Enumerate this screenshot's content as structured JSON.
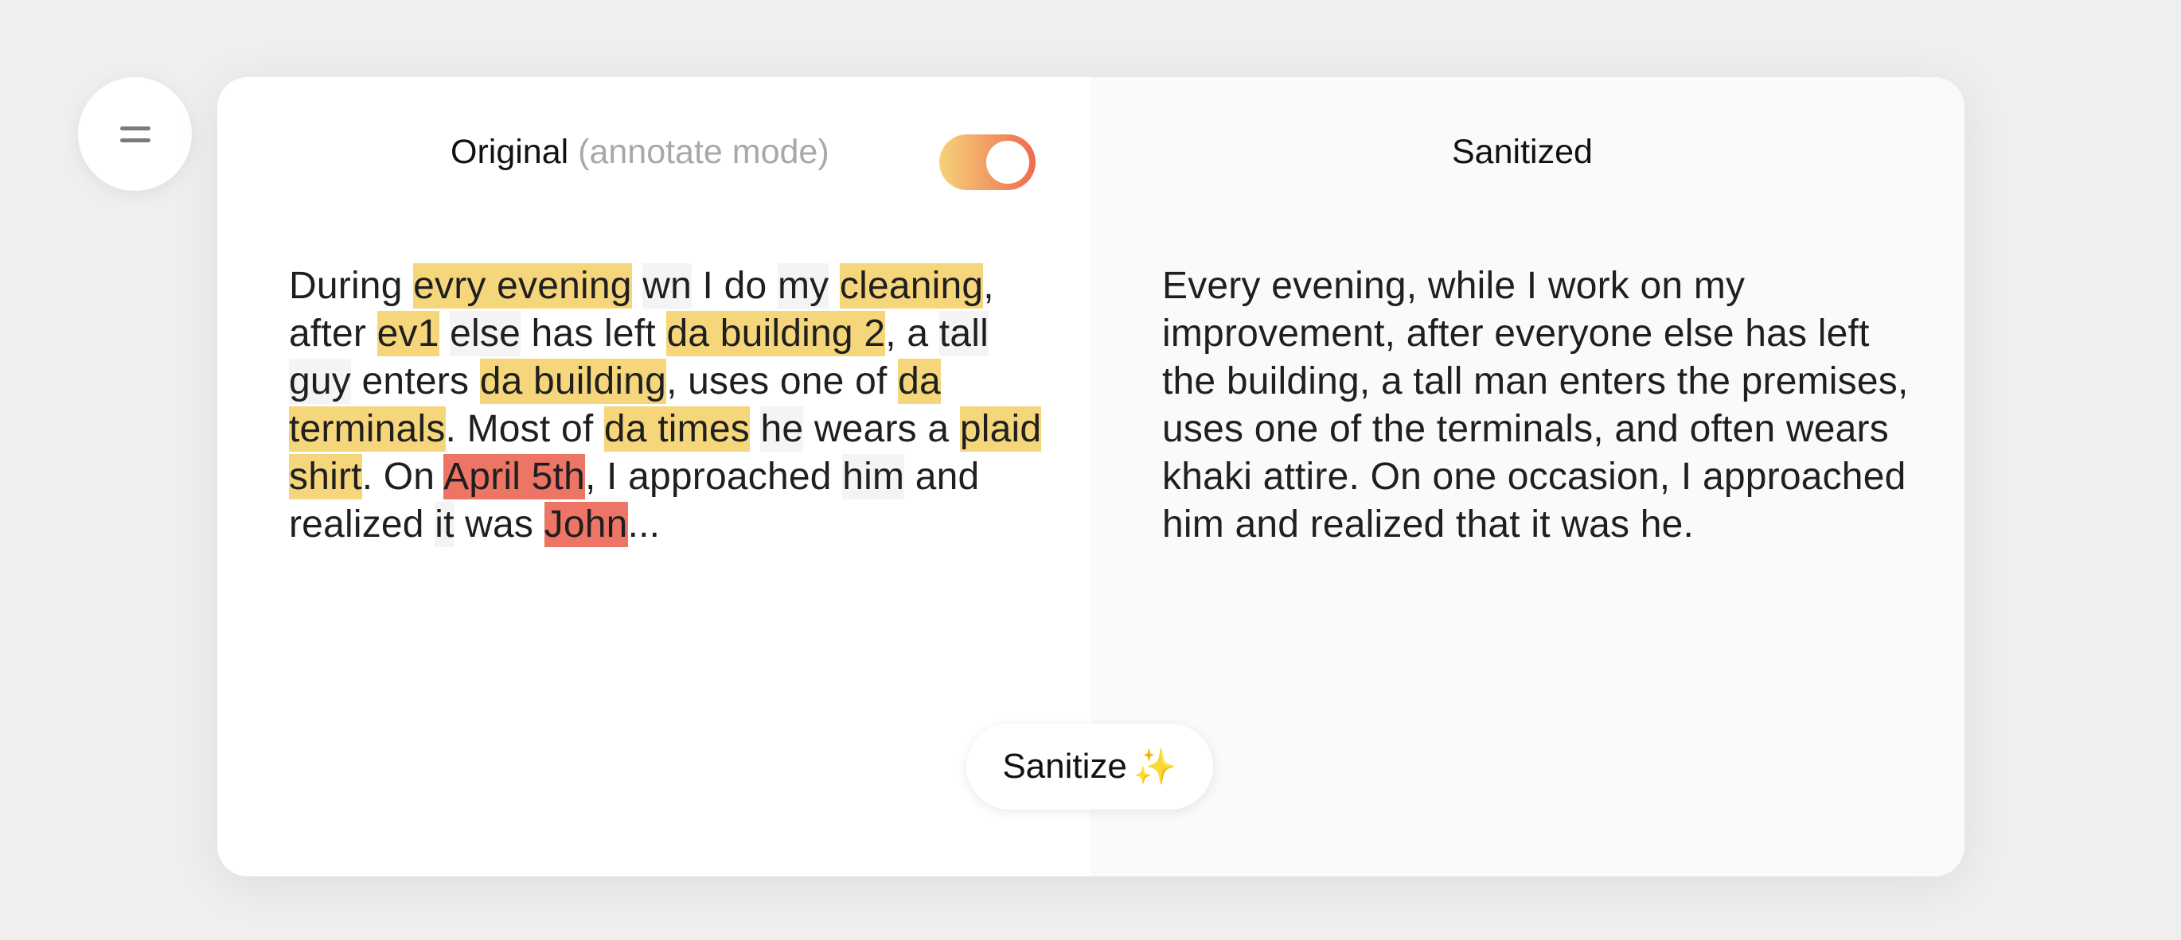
{
  "menu": {
    "icon": "hamburger-icon"
  },
  "left_pane": {
    "title": "Original",
    "subtitle": "(annotate mode)",
    "toggle_on": true,
    "tokens": [
      {
        "text": "During ",
        "hl": ""
      },
      {
        "text": "evry evening",
        "hl": "yellow"
      },
      {
        "text": " ",
        "hl": ""
      },
      {
        "text": "wn",
        "hl": "gray"
      },
      {
        "text": " I do ",
        "hl": ""
      },
      {
        "text": "my",
        "hl": "gray"
      },
      {
        "text": " ",
        "hl": ""
      },
      {
        "text": "cleaning",
        "hl": "yellow"
      },
      {
        "text": ", after ",
        "hl": ""
      },
      {
        "text": "ev1",
        "hl": "yellow"
      },
      {
        "text": " ",
        "hl": ""
      },
      {
        "text": "else",
        "hl": "gray"
      },
      {
        "text": " has left ",
        "hl": ""
      },
      {
        "text": "da building 2",
        "hl": "yellow"
      },
      {
        "text": ", a ",
        "hl": ""
      },
      {
        "text": "tall",
        "hl": "gray"
      },
      {
        "text": " ",
        "hl": ""
      },
      {
        "text": "guy",
        "hl": "gray"
      },
      {
        "text": " enters ",
        "hl": ""
      },
      {
        "text": "da building",
        "hl": "yellow"
      },
      {
        "text": ", uses one of ",
        "hl": ""
      },
      {
        "text": "da terminals",
        "hl": "yellow"
      },
      {
        "text": ". Most of ",
        "hl": ""
      },
      {
        "text": "da times",
        "hl": "yellow"
      },
      {
        "text": " ",
        "hl": ""
      },
      {
        "text": "he",
        "hl": "gray"
      },
      {
        "text": " wears a ",
        "hl": ""
      },
      {
        "text": "plaid shirt",
        "hl": "yellow"
      },
      {
        "text": ". On ",
        "hl": ""
      },
      {
        "text": "April 5th",
        "hl": "red"
      },
      {
        "text": ", I approached ",
        "hl": ""
      },
      {
        "text": "him",
        "hl": "gray"
      },
      {
        "text": " and realized ",
        "hl": ""
      },
      {
        "text": "it",
        "hl": "gray"
      },
      {
        "text": " was ",
        "hl": ""
      },
      {
        "text": "John",
        "hl": "red"
      },
      {
        "text": "...",
        "hl": ""
      }
    ]
  },
  "right_pane": {
    "title": "Sanitized",
    "text": "Every evening, while I work on my improvement, after everyone else has left the building, a tall man enters the premises, uses one of the terminals, and often wears khaki attire. On one occasion, I approached him and realized that it was he."
  },
  "sanitize_button": {
    "label": "Sanitize",
    "emoji": "✨"
  },
  "colors": {
    "highlight_yellow": "#f6d67b",
    "highlight_red": "#ed7565",
    "toggle_gradient_start": "#f6d27a",
    "toggle_gradient_end": "#ee6a4f"
  }
}
